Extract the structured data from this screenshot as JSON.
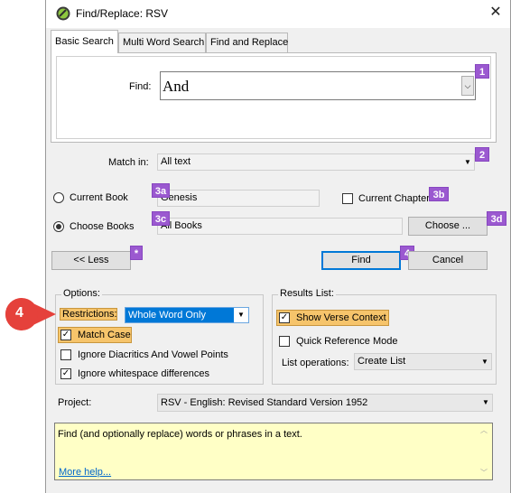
{
  "window": {
    "title": "Find/Replace: RSV"
  },
  "tabs": [
    {
      "label": "Basic Search"
    },
    {
      "label": "Multi Word Search"
    },
    {
      "label": "Find and Replace"
    }
  ],
  "find": {
    "label": "Find:",
    "value": "And"
  },
  "match_in": {
    "label": "Match in:",
    "value": "All text"
  },
  "current_book": {
    "label": "Current Book",
    "value": "Genesis"
  },
  "current_chapter": {
    "label": "Current Chapter"
  },
  "choose_books": {
    "label": "Choose Books",
    "value": "All Books",
    "button": "Choose ..."
  },
  "buttons": {
    "less": "<< Less",
    "find": "Find",
    "cancel": "Cancel"
  },
  "options": {
    "group_label": "Options:",
    "restrictions_label": "Restrictions:",
    "restrictions_value": "Whole Word Only",
    "match_case": "Match Case",
    "ignore_diacritics": "Ignore Diacritics And Vowel Points",
    "ignore_whitespace": "Ignore whitespace differences"
  },
  "results": {
    "group_label": "Results List:",
    "show_verse_context": "Show Verse Context",
    "quick_reference": "Quick Reference Mode",
    "list_operations_label": "List operations:",
    "list_operations_value": "Create List"
  },
  "project": {
    "label": "Project:",
    "value": "RSV -  English: Revised Standard Version 1952"
  },
  "help": {
    "text": "Find (and optionally replace) words or phrases in a text.",
    "link": "More help..."
  },
  "badges": {
    "b1": "1",
    "b2": "2",
    "b3a": "3a",
    "b3b": "3b",
    "b3c": "3c",
    "b3d": "3d",
    "b4": "4",
    "bstar": "*",
    "callout": "4"
  },
  "colors": {
    "badge": "#9b59d0",
    "callout": "#e5413b",
    "highlight": "#f6c46b",
    "help_bg": "#ffffc6",
    "link": "#0066cc"
  }
}
